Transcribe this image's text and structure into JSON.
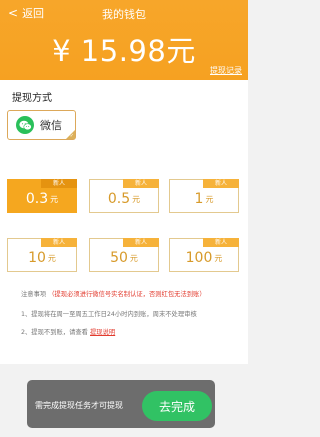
{
  "header": {
    "back_label": "返回",
    "title": "我的钱包",
    "balance": "¥ 15.98元",
    "record_link": "提现记录"
  },
  "method": {
    "section_title": "提现方式",
    "wechat_label": "微信",
    "wechat_icon": "wechat-icon",
    "brand_green": "#2ac05a"
  },
  "amounts": {
    "items": [
      {
        "value": "0.3",
        "unit": "元",
        "tag": "新人",
        "selected": true
      },
      {
        "value": "0.5",
        "unit": "元",
        "tag": "新人",
        "selected": false
      },
      {
        "value": "1",
        "unit": "元",
        "tag": "新人",
        "selected": false
      },
      {
        "value": "10",
        "unit": "元",
        "tag": "新人",
        "selected": false
      },
      {
        "value": "50",
        "unit": "元",
        "tag": "新人",
        "selected": false
      },
      {
        "value": "100",
        "unit": "元",
        "tag": "新人",
        "selected": false
      }
    ],
    "accent_color": "#f5a71f"
  },
  "notes": {
    "label": "注意事项",
    "highlight": "提现必须进行微信号实名制认证，否则红包无法到账",
    "line1": "1、提现将在周一至周五工作日24小时内到账，周末不处理审核",
    "line2_prefix": "2、提现不到账，请查看",
    "line2_link": "提现说明"
  },
  "bottom": {
    "prompt": "需完成提现任务才可提现",
    "button_label": "去完成"
  }
}
